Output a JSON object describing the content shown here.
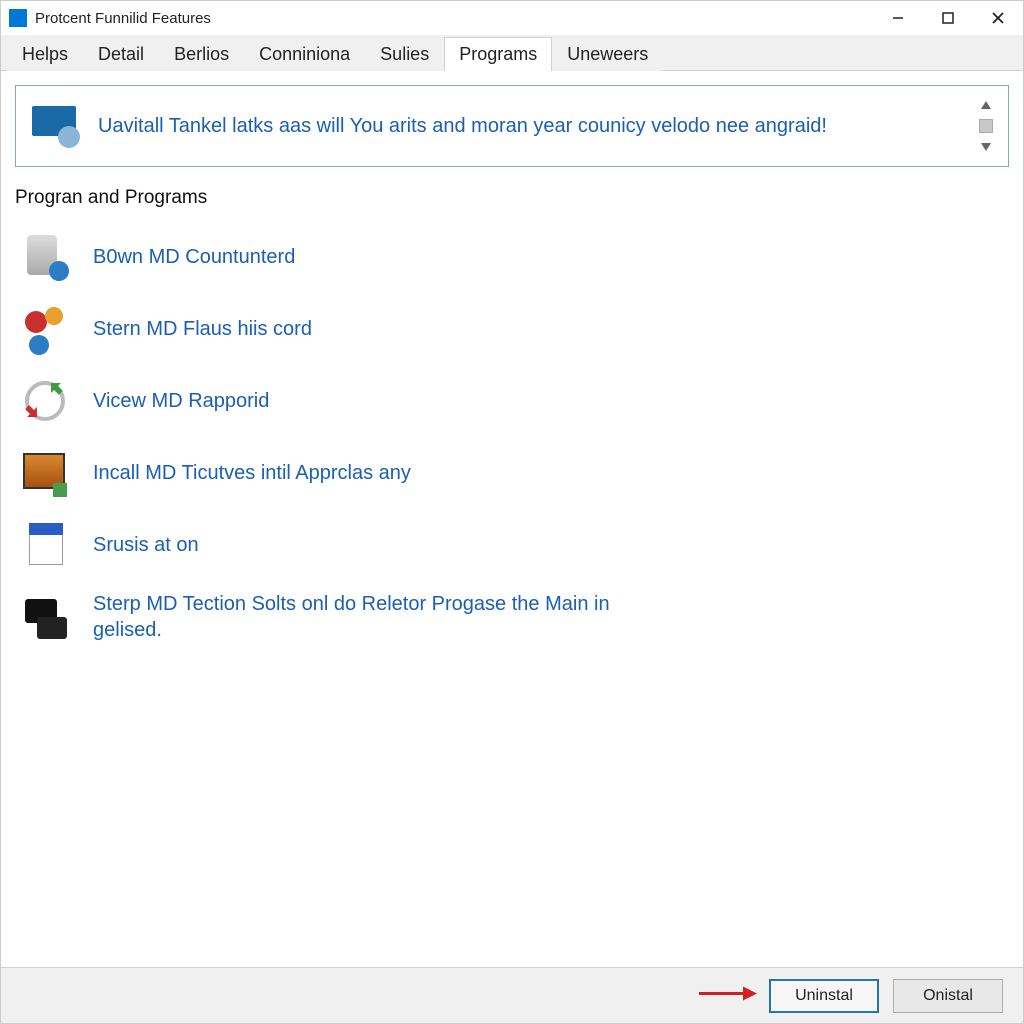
{
  "window": {
    "title": "Protcent Funnilid Features"
  },
  "tabs": [
    {
      "label": "Helps"
    },
    {
      "label": "Detail"
    },
    {
      "label": "Berlios"
    },
    {
      "label": "Conniniona"
    },
    {
      "label": "Sulies"
    },
    {
      "label": "Programs"
    },
    {
      "label": "Uneweers"
    }
  ],
  "active_tab_index": 5,
  "banner": {
    "text": "Uavitall Tankel latks aas will You arits and moran year counicy velodo nee angraid!"
  },
  "section_title": "Progran and Programs",
  "programs": [
    {
      "label": "B0wn MD Countunterd"
    },
    {
      "label": "Stern MD Flaus hiis cord"
    },
    {
      "label": "Vicew MD Rapporid"
    },
    {
      "label": "Incall MD Ticutves intil Apprclas any"
    },
    {
      "label": "Srusis at on"
    },
    {
      "label": "Sterp MD Tection Solts onl do Reletor Progase the Main in gelised."
    }
  ],
  "footer": {
    "uninstall": "Uninstal",
    "onistal": "Onistal"
  }
}
